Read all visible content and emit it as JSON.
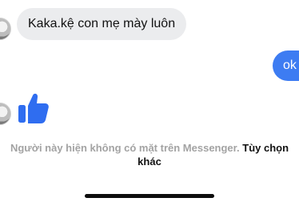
{
  "conversation": {
    "incoming_text": "Kaka.kệ con mẹ mày luôn",
    "outgoing_text": "ok",
    "like_reaction": "thumbs-up-icon"
  },
  "footer": {
    "status_text": "Người này hiện không có mặt trên Messenger.",
    "options_link": "Tùy chọn khác"
  },
  "colors": {
    "incoming_bubble": "#ebecee",
    "outgoing_bubble": "#3d7cf2",
    "like_icon": "#2f6df0",
    "muted_text": "#a3a3a3"
  }
}
